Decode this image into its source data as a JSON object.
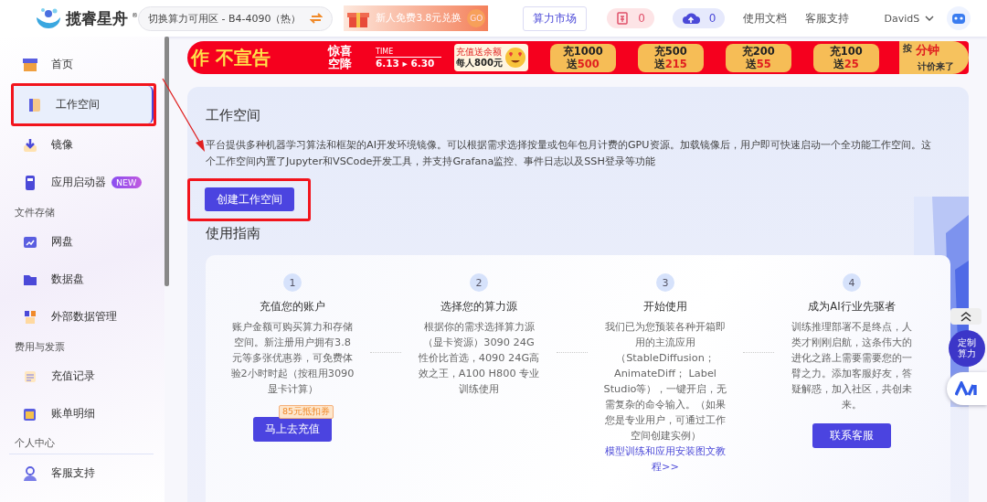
{
  "header": {
    "logo": "揽睿星舟",
    "logo_mark": "®",
    "zone_selector": "切换算力可用区 - B4-4090（热）",
    "promo": "新人免费3.8元兑换",
    "promo_go": "GO",
    "market_button": "算力市场",
    "coupon_count": "0",
    "upload_count": "0",
    "links": [
      "使用文档",
      "客服支持"
    ],
    "user": "DavidS"
  },
  "sidebar": {
    "items": [
      {
        "kind": "item",
        "label": "首页",
        "selected": false,
        "highlighted": false
      },
      {
        "kind": "item",
        "label": "工作空间",
        "selected": true,
        "highlighted": true
      },
      {
        "kind": "item",
        "label": "镜像",
        "selected": false,
        "highlighted": false
      },
      {
        "kind": "item",
        "label": "应用启动器",
        "badge": "NEW",
        "selected": false,
        "highlighted": false
      },
      {
        "kind": "section",
        "label": "文件存储"
      },
      {
        "kind": "item",
        "label": "网盘",
        "selected": false,
        "highlighted": false
      },
      {
        "kind": "item",
        "label": "数据盘",
        "selected": false,
        "highlighted": false
      },
      {
        "kind": "item",
        "label": "外部数据管理",
        "selected": false,
        "highlighted": false
      },
      {
        "kind": "section",
        "label": "费用与发票"
      },
      {
        "kind": "item",
        "label": "充值记录",
        "selected": false,
        "highlighted": false
      },
      {
        "kind": "item",
        "label": "账单明细",
        "selected": false,
        "highlighted": false
      },
      {
        "kind": "section",
        "label": "个人中心"
      },
      {
        "kind": "item",
        "label": "客服支持",
        "selected": false,
        "highlighted": false
      }
    ]
  },
  "banner": {
    "slogan": "作 不宣告",
    "event": "惊喜空降",
    "time_label": "TIME",
    "dates": "6.13 ▸ 6.30",
    "card_lines": [
      "充值送余额",
      "每人800元"
    ],
    "offers": [
      {
        "top": "充1000",
        "label": "送",
        "bonus": "500"
      },
      {
        "top": "充500",
        "label": "送",
        "bonus": "215"
      },
      {
        "top": "充200",
        "label": "送",
        "bonus": "55"
      },
      {
        "top": "充100",
        "label": "送",
        "bonus": "25"
      }
    ],
    "tail": [
      "按",
      "分钟",
      "计价来了"
    ]
  },
  "workspace": {
    "title": "工作空间",
    "description": "平台提供多种机器学习算法和框架的AI开发环境镜像。可以根据需求选择按量或包年包月计费的GPU资源。加载镜像后，用户即可快速启动一个全功能工作空间。这个工作空间内置了Jupyter和VSCode开发工具，并支持Grafana监控、事件日志以及SSH登录等功能",
    "create_button": "创建工作空间",
    "create_highlighted": true,
    "annotation_arrow": true
  },
  "guide": {
    "title": "使用指南",
    "steps": [
      {
        "number": "1",
        "title": "充值您的账户",
        "description": "账户金额可购买算力和存储空间。新注册用户拥有3.8元等多张优惠券，可免费体验2小时时起（按租用3090显卡计算）",
        "kind": "button",
        "action": "马上去充值",
        "tag": "85元抵扣券"
      },
      {
        "number": "2",
        "title": "选择您的算力源",
        "description": "根据你的需求选择算力源（显卡资源）3090 24G 性价比首选，4090 24G高效之王，A100 H800 专业训练使用",
        "kind": "none"
      },
      {
        "number": "3",
        "title": "开始使用",
        "description": "我们已为您预装各种开箱即用的主流应用（StableDiffusion；AnimateDiff； Label Studio等），一键开启，无需复杂的命令输入。（如果您是专业用户，可通过工作空间创建实例）",
        "kind": "link",
        "action": "模型训练和应用安装图文教程>>"
      },
      {
        "number": "4",
        "title": "成为AI行业先驱者",
        "description": "训练推理部署不是终点，人类才刚刚启航，这条伟大的进化之路上需要需要您的一臂之力。添加客服好友，答疑解惑，加入社区，共创未来。",
        "kind": "button",
        "action": "联系客服"
      }
    ]
  },
  "float": {
    "custom": "定制算力"
  }
}
